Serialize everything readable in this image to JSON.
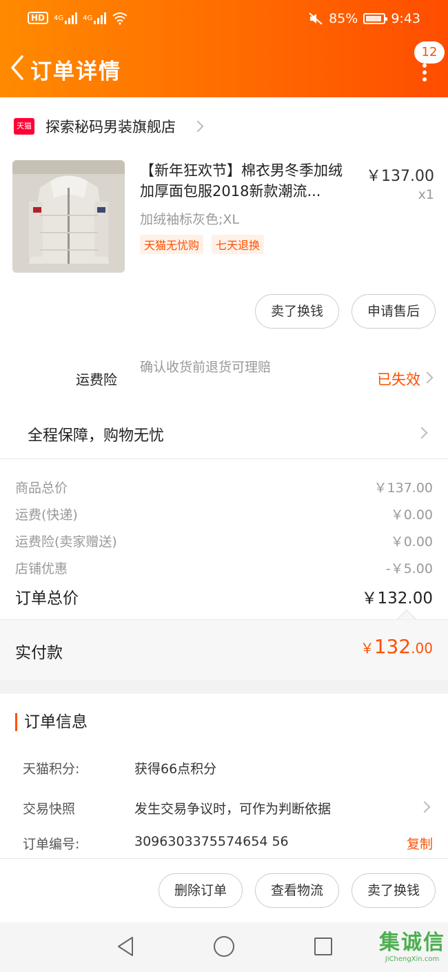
{
  "status_bar": {
    "hd": "HD",
    "network1": "4G",
    "network2": "4G",
    "battery_percent": "85%",
    "time": "9:43",
    "icons": [
      "signal-icon",
      "wifi-icon",
      "mute-icon",
      "battery-icon"
    ]
  },
  "nav": {
    "title": "订单详情",
    "message_count": "12",
    "accent_color": "#ff5000"
  },
  "shop": {
    "logo_text": "天猫",
    "name": "探索秘码男装旗舰店"
  },
  "product": {
    "title": "【新年狂欢节】棉衣男冬季加绒加厚面包服2018新款潮流...",
    "price": "￥137.00",
    "quantity": "x1",
    "sku": "加绒袖标灰色;XL",
    "tags": [
      "天猫无忧购",
      "七天退换"
    ],
    "actions": [
      "卖了换钱",
      "申请售后"
    ]
  },
  "insurance": {
    "label": "运费险",
    "desc": "确认收货前退货可理赔",
    "status": "已失效"
  },
  "guarantee": "全程保障，购物无忧",
  "summary": {
    "rows": [
      {
        "label": "商品总价",
        "value": "￥137.00"
      },
      {
        "label": "运费(快递)",
        "value": "￥0.00"
      },
      {
        "label": "运费险(卖家赠送)",
        "value": "￥0.00"
      },
      {
        "label": "店铺优惠",
        "value": "-￥5.00"
      }
    ],
    "total_label": "订单总价",
    "total_value": "￥132.00"
  },
  "paid": {
    "label": "实付款",
    "symbol": "￥",
    "integer": "132",
    "decimal": ".00"
  },
  "order_info": {
    "title": "订单信息",
    "points_label": "天猫积分:",
    "points_value": "获得66点积分",
    "snapshot_label": "交易快照",
    "snapshot_value": "发生交易争议时，可作为判断依据",
    "order_no_label": "订单编号:",
    "order_no_value": "3096303375574654 56",
    "copy_label": "复制"
  },
  "bottom_actions": [
    "删除订单",
    "查看物流",
    "卖了换钱"
  ],
  "watermark": {
    "cn": "集诚信",
    "en": "JiChengXin.com"
  }
}
